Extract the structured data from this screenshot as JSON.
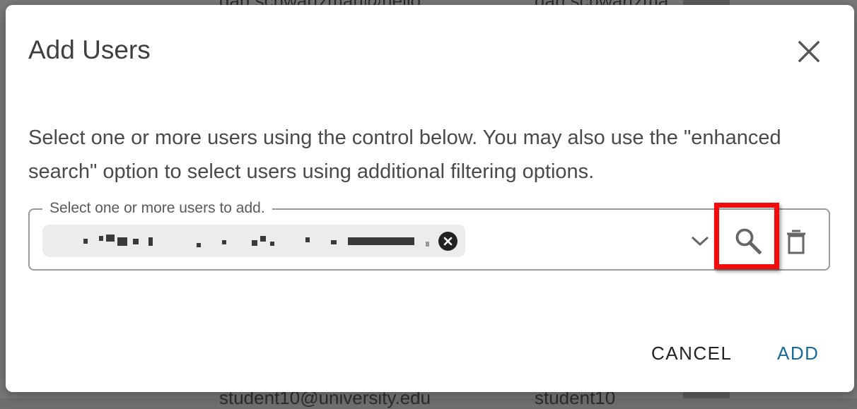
{
  "background": {
    "top_row": {
      "email": "dan.schwartzman@hello...",
      "name": "dan.schwartzma"
    },
    "bottom_row": {
      "email": "student10@university.edu",
      "name": "student10"
    }
  },
  "dialog": {
    "title": "Add Users",
    "close_icon": "close-icon",
    "description": "Select one or more users using the control below. You may also use the \"enhanced search\" option to select users using additional filtering options.",
    "field": {
      "label": "Select one or more users to add.",
      "selected_chip": {
        "text_pixelated": true,
        "remove_icon": "cancel-circle-icon"
      },
      "dropdown_icon": "chevron-down-icon",
      "search_icon": "search-icon",
      "clear_icon": "trash-icon"
    },
    "buttons": {
      "cancel": "CANCEL",
      "add": "ADD"
    },
    "colors": {
      "primary": "#1b6a97",
      "highlight": "#f20b0b"
    }
  }
}
